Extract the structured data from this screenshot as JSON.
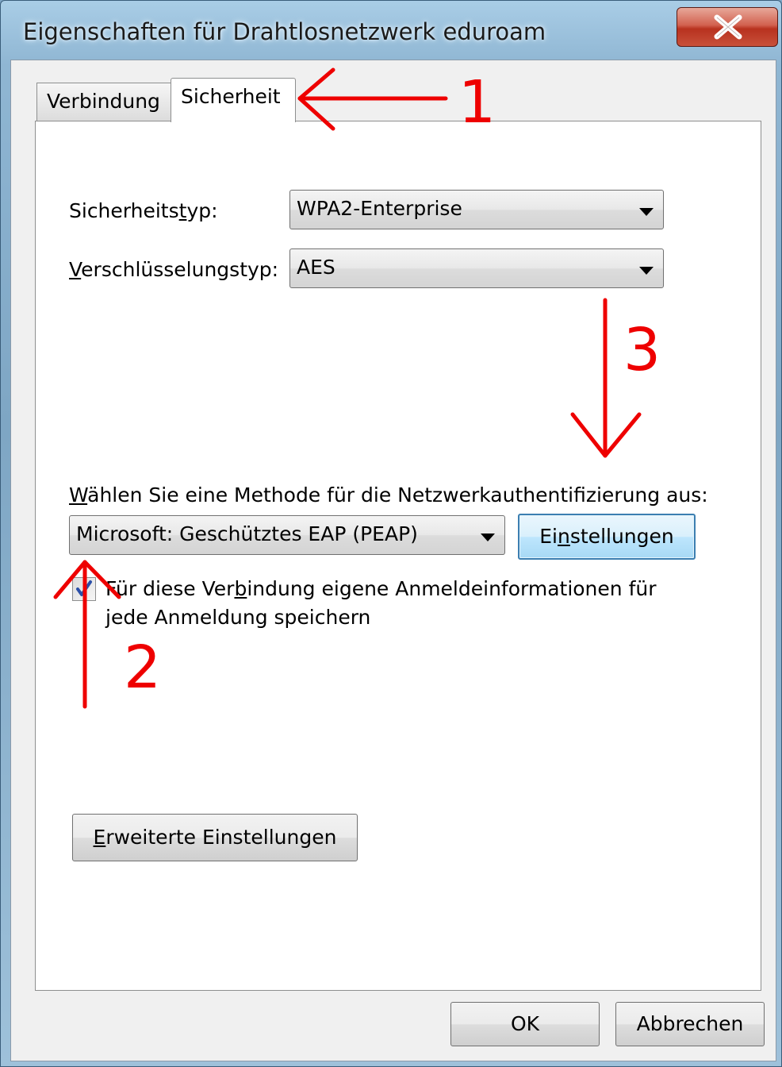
{
  "window": {
    "title": "Eigenschaften für Drahtlosnetzwerk eduroam"
  },
  "tabs": [
    {
      "label": "Verbindung",
      "selected": false
    },
    {
      "label": "Sicherheit",
      "selected": true
    }
  ],
  "security": {
    "type_label_pre": "Sicherheits",
    "type_label_u": "t",
    "type_label_post": "yp:",
    "type_value": "WPA2-Enterprise",
    "encryption_label_u": "V",
    "encryption_label_post": "erschlüsselungstyp:",
    "encryption_value": "AES"
  },
  "auth": {
    "method_label_u": "W",
    "method_label_post": "ählen Sie eine Methode für die Netzwerkauthentifizierung aus:",
    "method_value": "Microsoft: Geschütztes EAP (PEAP)",
    "settings_pre": "Ei",
    "settings_u": "n",
    "settings_post": "stellungen"
  },
  "remember": {
    "checked": true,
    "line1_pre": "Für diese Ver",
    "line1_u": "b",
    "line1_post": "indung eigene Anmeldeinformationen für",
    "line2": "jede Anmeldung speichern"
  },
  "advanced": {
    "label_u": "E",
    "label_post": "rweiterte Einstellungen"
  },
  "footer": {
    "ok_label": "OK",
    "cancel_label": "Abbrechen"
  },
  "annotations": {
    "step1": "1",
    "step2": "2",
    "step3": "3",
    "color": "#ee0000"
  }
}
